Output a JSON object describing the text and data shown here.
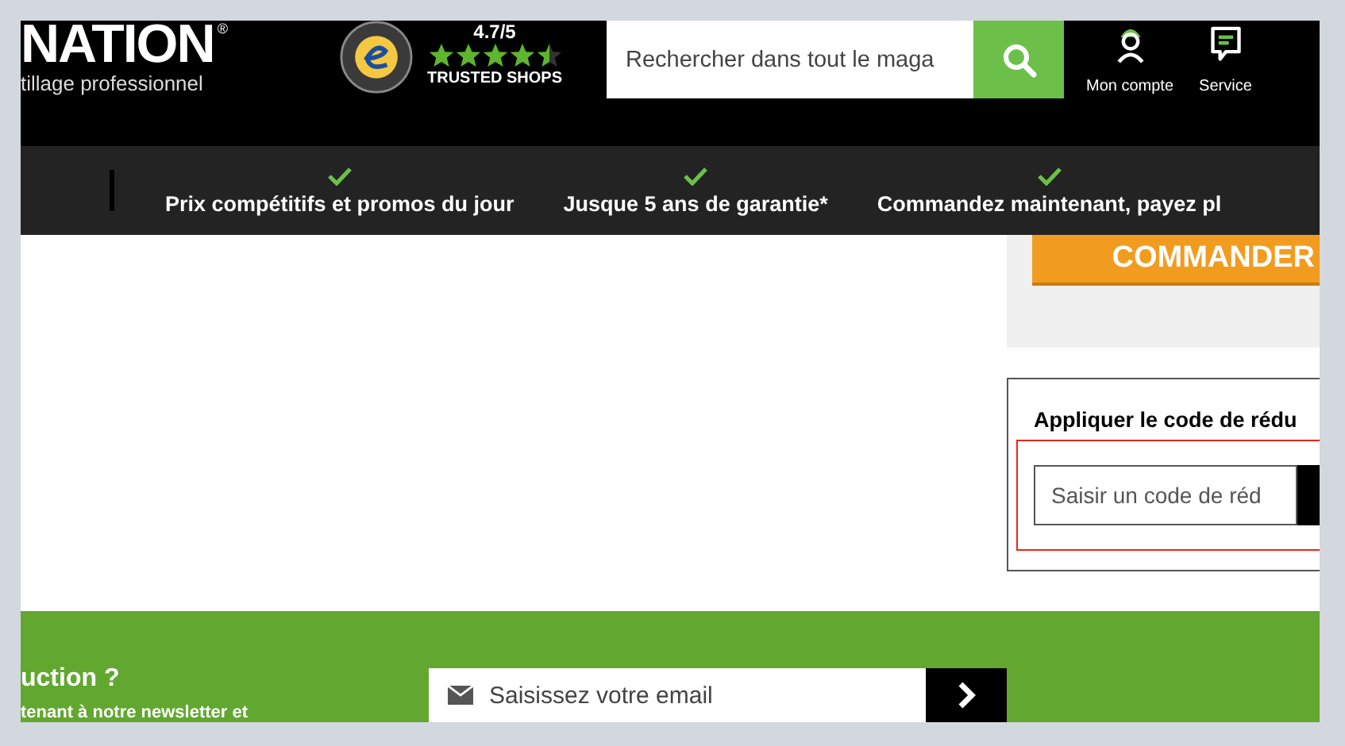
{
  "header": {
    "logo": "NATION",
    "logo_mark": "®",
    "tagline": "tillage professionnel",
    "rating": "4.7/5",
    "stars": 4.5,
    "trust_label": "TRUSTED SHOPS",
    "search": {
      "placeholder": "Rechercher dans tout le maga"
    },
    "account_links": [
      {
        "kind": "account",
        "label": "Mon compte"
      },
      {
        "kind": "service",
        "label": "Service"
      }
    ]
  },
  "usp_bar": [
    {
      "label": "Prix compétitifs et promos du jour"
    },
    {
      "label": "Jusque 5 ans de garantie*"
    },
    {
      "label": "Commandez maintenant, payez pl"
    }
  ],
  "checkout": {
    "order_button": "COMMANDER",
    "discount": {
      "title": "Appliquer le code de rédu",
      "placeholder": "Saisir un code de réd"
    }
  },
  "footer": {
    "heading": "uction ?",
    "text": "tenant à notre newsletter et",
    "email": {
      "placeholder": "Saisissez votre email"
    }
  }
}
